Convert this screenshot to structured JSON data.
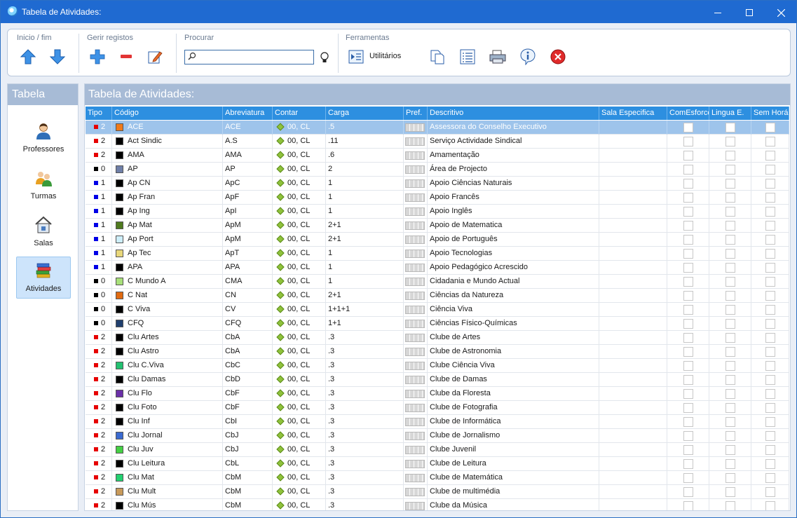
{
  "window": {
    "title": "Tabela de Atividades:"
  },
  "colors": {
    "titlebar": "#1f6ad1",
    "header_blue": "#2d8fe0",
    "selected_row": "#9ec4eb",
    "panel_header": "#a7bbd6",
    "tipo_red": "#e60000",
    "tipo_blue": "#0000e6",
    "tipo_black": "#000000"
  },
  "ribbon": {
    "groups": [
      {
        "title": "Inicio / fim",
        "tools": [
          "arrow-up-icon",
          "arrow-down-icon"
        ]
      },
      {
        "title": "Gerir registos",
        "tools": [
          "plus-icon",
          "minus-icon",
          "edit-icon"
        ]
      },
      {
        "title": "Procurar",
        "search": {
          "value": "",
          "placeholder": ""
        }
      },
      {
        "title": "Ferramentas",
        "utilitarios_label": "Utilitários",
        "tools": [
          "utilities-icon",
          "copy-icon",
          "list-icon",
          "print-icon",
          "info-icon",
          "close-circle-icon"
        ]
      }
    ]
  },
  "sidebar": {
    "title": "Tabela",
    "items": [
      {
        "label": "Professores",
        "icon": "teacher-icon",
        "active": false
      },
      {
        "label": "Turmas",
        "icon": "class-group-icon",
        "active": false
      },
      {
        "label": "Salas",
        "icon": "room-icon",
        "active": false
      },
      {
        "label": "Atividades",
        "icon": "books-icon",
        "active": true
      }
    ]
  },
  "panel": {
    "title": "Tabela de Atividades:",
    "columns": [
      "Tipo",
      "Código",
      "Abreviatura",
      "Contar",
      "Carga",
      "Pref.",
      "Descritivo",
      "Sala Especifica",
      "ComEsforco",
      "Lingua E.",
      "Sem Horá"
    ],
    "rows": [
      {
        "tipo_color": "#e60000",
        "tipo": "2",
        "swatch": "#f07a1a",
        "codigo": "ACE",
        "abrev": "ACE",
        "contar": "00, CL",
        "carga": ".5",
        "descritivo": "Assessora do Conselho Executivo",
        "selected": true
      },
      {
        "tipo_color": "#e60000",
        "tipo": "2",
        "swatch": "#000000",
        "codigo": "Act Sindic",
        "abrev": "A.S",
        "contar": "00, CL",
        "carga": ".11",
        "descritivo": "Serviço Actividade Sindical"
      },
      {
        "tipo_color": "#e60000",
        "tipo": "2",
        "swatch": "#000000",
        "codigo": "AMA",
        "abrev": "AMA",
        "contar": "00, CL",
        "carga": ".6",
        "descritivo": "Amamentação"
      },
      {
        "tipo_color": "#000000",
        "tipo": "0",
        "swatch": "#6f7fa8",
        "codigo": "AP",
        "abrev": "AP",
        "contar": "00, CL",
        "carga": "2",
        "descritivo": "Área de Projecto"
      },
      {
        "tipo_color": "#0000e6",
        "tipo": "1",
        "swatch": "#000000",
        "codigo": "Ap CN",
        "abrev": "ApC",
        "contar": "00, CL",
        "carga": "1",
        "descritivo": "Apoio Ciências Naturais"
      },
      {
        "tipo_color": "#0000e6",
        "tipo": "1",
        "swatch": "#000000",
        "codigo": "Ap Fran",
        "abrev": "ApF",
        "contar": "00, CL",
        "carga": "1",
        "descritivo": "Apoio Francês"
      },
      {
        "tipo_color": "#0000e6",
        "tipo": "1",
        "swatch": "#000000",
        "codigo": "Ap Ing",
        "abrev": "ApI",
        "contar": "00, CL",
        "carga": "1",
        "descritivo": "Apoio Inglês"
      },
      {
        "tipo_color": "#0000e6",
        "tipo": "1",
        "swatch": "#4f7a1e",
        "codigo": "Ap Mat",
        "abrev": "ApM",
        "contar": "00, CL",
        "carga": "2+1",
        "descritivo": "Apoio de Matematica"
      },
      {
        "tipo_color": "#0000e6",
        "tipo": "1",
        "swatch": "#cdeefa",
        "codigo": "Ap Port",
        "abrev": "ApM",
        "contar": "00, CL",
        "carga": "2+1",
        "descritivo": "Apoio de Português"
      },
      {
        "tipo_color": "#0000e6",
        "tipo": "1",
        "swatch": "#e8d77a",
        "codigo": "Ap Tec",
        "abrev": "ApT",
        "contar": "00, CL",
        "carga": "1",
        "descritivo": "Apoio Tecnologias"
      },
      {
        "tipo_color": "#0000e6",
        "tipo": "1",
        "swatch": "#000000",
        "codigo": "APA",
        "abrev": "APA",
        "contar": "00, CL",
        "carga": "1",
        "descritivo": "Apoio Pedagógico Acrescido"
      },
      {
        "tipo_color": "#000000",
        "tipo": "0",
        "swatch": "#a8e07a",
        "codigo": "C Mundo A",
        "abrev": "CMA",
        "contar": "00, CL",
        "carga": "1",
        "descritivo": "Cidadania e Mundo Actual"
      },
      {
        "tipo_color": "#000000",
        "tipo": "0",
        "swatch": "#e06a10",
        "codigo": "C Nat",
        "abrev": "CN",
        "contar": "00, CL",
        "carga": "2+1",
        "descritivo": "Ciências da Natureza"
      },
      {
        "tipo_color": "#000000",
        "tipo": "0",
        "swatch": "#000000",
        "codigo": "C Viva",
        "abrev": "CV",
        "contar": "00, CL",
        "carga": "1+1+1",
        "descritivo": "Ciência Viva"
      },
      {
        "tipo_color": "#000000",
        "tipo": "0",
        "swatch": "#1f3f6e",
        "codigo": "CFQ",
        "abrev": "CFQ",
        "contar": "00, CL",
        "carga": "1+1",
        "descritivo": "Ciências Físico-Químicas"
      },
      {
        "tipo_color": "#e60000",
        "tipo": "2",
        "swatch": "#000000",
        "codigo": "Clu Artes",
        "abrev": "CbA",
        "contar": "00, CL",
        "carga": ".3",
        "descritivo": "Clube de Artes"
      },
      {
        "tipo_color": "#e60000",
        "tipo": "2",
        "swatch": "#000000",
        "codigo": "Clu Astro",
        "abrev": "CbA",
        "contar": "00, CL",
        "carga": ".3",
        "descritivo": "Clube de Astronomia"
      },
      {
        "tipo_color": "#e60000",
        "tipo": "2",
        "swatch": "#22c070",
        "codigo": "Clu C.Viva",
        "abrev": "CbC",
        "contar": "00, CL",
        "carga": ".3",
        "descritivo": "Clube Ciência Viva"
      },
      {
        "tipo_color": "#e60000",
        "tipo": "2",
        "swatch": "#000000",
        "codigo": "Clu Damas",
        "abrev": "CbD",
        "contar": "00, CL",
        "carga": ".3",
        "descritivo": "Clube de Damas"
      },
      {
        "tipo_color": "#e60000",
        "tipo": "2",
        "swatch": "#6a2fa8",
        "codigo": "Clu Flo",
        "abrev": "CbF",
        "contar": "00, CL",
        "carga": ".3",
        "descritivo": "Clube da Floresta"
      },
      {
        "tipo_color": "#e60000",
        "tipo": "2",
        "swatch": "#000000",
        "codigo": "Clu Foto",
        "abrev": "CbF",
        "contar": "00, CL",
        "carga": ".3",
        "descritivo": "Clube de Fotografia"
      },
      {
        "tipo_color": "#e60000",
        "tipo": "2",
        "swatch": "#000000",
        "codigo": "Clu Inf",
        "abrev": "CbI",
        "contar": "00, CL",
        "carga": ".3",
        "descritivo": "Clube de Informática"
      },
      {
        "tipo_color": "#e60000",
        "tipo": "2",
        "swatch": "#3a6ad0",
        "codigo": "Clu Jornal",
        "abrev": "CbJ",
        "contar": "00, CL",
        "carga": ".3",
        "descritivo": "Clube de Jornalismo"
      },
      {
        "tipo_color": "#e60000",
        "tipo": "2",
        "swatch": "#44d044",
        "codigo": "Clu Juv",
        "abrev": "CbJ",
        "contar": "00, CL",
        "carga": ".3",
        "descritivo": "Clube Juvenil"
      },
      {
        "tipo_color": "#e60000",
        "tipo": "2",
        "swatch": "#000000",
        "codigo": "Clu Leitura",
        "abrev": "CbL",
        "contar": "00, CL",
        "carga": ".3",
        "descritivo": "Clube de Leitura"
      },
      {
        "tipo_color": "#e60000",
        "tipo": "2",
        "swatch": "#22d070",
        "codigo": "Clu Mat",
        "abrev": "CbM",
        "contar": "00, CL",
        "carga": ".3",
        "descritivo": "Clube de Matemática"
      },
      {
        "tipo_color": "#e60000",
        "tipo": "2",
        "swatch": "#c89a5a",
        "codigo": "Clu Mult",
        "abrev": "CbM",
        "contar": "00, CL",
        "carga": ".3",
        "descritivo": "Clube de multimédia"
      },
      {
        "tipo_color": "#e60000",
        "tipo": "2",
        "swatch": "#000000",
        "codigo": "Clu Mús",
        "abrev": "CbM",
        "contar": "00, CL",
        "carga": ".3",
        "descritivo": "Clube da Música"
      }
    ]
  }
}
